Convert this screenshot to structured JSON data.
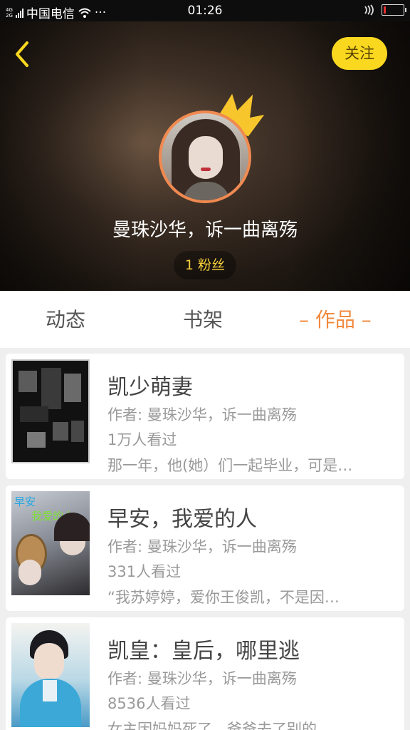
{
  "status_bar": {
    "network": "4G",
    "network2": "2G",
    "carrier": "中国电信",
    "more": "···",
    "time": "01:26"
  },
  "header": {
    "back_icon": "chevron-left-icon",
    "follow_label": "关注",
    "username": "曼珠沙华，诉一曲离殇",
    "fans": "1 粉丝",
    "accent_color": "#f9d81f"
  },
  "tabs": [
    {
      "label": "动态",
      "active": false
    },
    {
      "label": "书架",
      "active": false
    },
    {
      "label": "– 作品 –",
      "active": true
    }
  ],
  "books": [
    {
      "title": "凯少萌妻",
      "author": "作者: 曼珠沙华，诉一曲离殇",
      "views": "1万人看过",
      "desc": "那一年，他(她）们一起毕业，可是…"
    },
    {
      "title": "早安，我爱的人",
      "author": "作者: 曼珠沙华，诉一曲离殇",
      "views": "331人看过",
      "desc": "“我苏婷婷，爱你王俊凯，不是因…",
      "cover_text_1": "早安",
      "cover_text_2": "我爱的人"
    },
    {
      "title": "凯皇：皇后，哪里逃",
      "author": "作者: 曼珠沙华，诉一曲离殇",
      "views": "8536人看过",
      "desc": "女主因妈妈死了，爸爸去了别的…"
    }
  ]
}
